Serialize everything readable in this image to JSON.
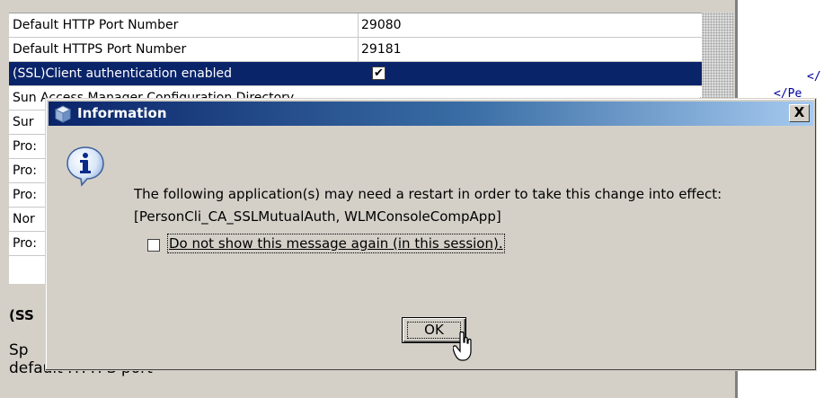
{
  "property_sheet": {
    "rows": [
      {
        "name": "Default HTTP Port Number",
        "value": "29080"
      },
      {
        "name": "Default HTTPS Port Number",
        "value": "29181"
      },
      {
        "name": "(SSL)Client authentication enabled",
        "checked": true
      },
      {
        "name": "Sun Access Manager Configuration Directory",
        "value": ""
      },
      {
        "name": "Sur",
        "value": ""
      },
      {
        "name": "Pro:",
        "value": ""
      },
      {
        "name": "Pro:",
        "value": ""
      },
      {
        "name": "Pro:",
        "value": ""
      },
      {
        "name": "Nor",
        "value": ""
      },
      {
        "name": "Pro:",
        "value": ""
      }
    ],
    "description_title": "(SS",
    "description_text_1": "Sp",
    "description_text_2": "default HTTPS port"
  },
  "code_editor": {
    "line1": "</",
    "line2": "</Pe"
  },
  "dialog": {
    "title": "Information",
    "close_label": "X",
    "message_line1": "The following application(s) may need a restart in order to take this change into effect:",
    "message_line2": "[PersonCli_CA_SSLMutualAuth, WLMConsoleCompApp]",
    "checkbox_label": "Do not show this message again (in this session).",
    "checkbox_checked": false,
    "ok_label": "OK"
  },
  "colors": {
    "selection": "#0a246a",
    "titlebar_start": "#0a246a",
    "titlebar_end": "#a6caf0",
    "dialog_face": "#d4d0c8",
    "code_text": "#0000a0"
  },
  "icons": [
    "info-icon",
    "window-icon",
    "close-icon",
    "mouse-cursor-icon",
    "checkmark-icon"
  ]
}
